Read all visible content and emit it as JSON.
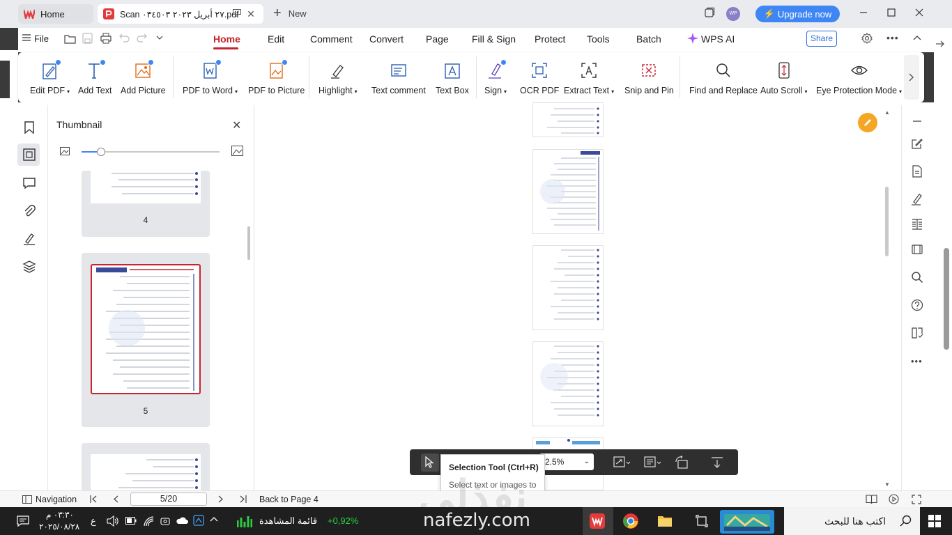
{
  "titlebar": {
    "tab_home": "Home",
    "tab_doc": "Scan ٢٧ أبريل ٢٠٢٣ ٠٣٤٥٠٣.pdf",
    "new_tab": "New",
    "avatar": "WP",
    "upgrade": "Upgrade now"
  },
  "menu": {
    "file": "File",
    "items": [
      "Home",
      "Edit",
      "Comment",
      "Convert",
      "Page",
      "Fill & Sign",
      "Protect",
      "Tools",
      "Batch"
    ],
    "wps_ai": "WPS AI",
    "share": "Share"
  },
  "ribbon": {
    "edit_pdf": "Edit PDF",
    "add_text": "Add Text",
    "add_picture": "Add Picture",
    "pdf_to_word": "PDF to Word",
    "pdf_to_picture": "PDF to Picture",
    "highlight": "Highlight",
    "text_comment": "Text comment",
    "text_box": "Text Box",
    "sign": "Sign",
    "ocr_pdf": "OCR PDF",
    "extract_text": "Extract Text",
    "snip_and_pin": "Snip and Pin",
    "find_replace": "Find and Replace",
    "auto_scroll": "Auto Scroll",
    "eye_protection": "Eye Protection Mode"
  },
  "thumbnail": {
    "title": "Thumbnail",
    "page_a": "4",
    "page_b": "5",
    "selected_page": 5
  },
  "float_toolbar": {
    "zoom": "2.5%"
  },
  "tooltip": {
    "title": "Selection Tool (Ctrl+R)",
    "desc": "Select text or images to copy"
  },
  "status": {
    "navigation": "Navigation",
    "page": "5/20",
    "back": "Back to Page 4"
  },
  "watermark": "نفذلي",
  "taskbar": {
    "time": "٠٣:٣٠ م",
    "date": "٢٠٢٥/٠٨/٢٨",
    "lang": "ع",
    "watchlist": "قائمة المشاهدة",
    "change": "+0,92%",
    "brand": "nafezly.com",
    "search": "اكتب هنا للبحث"
  },
  "colors": {
    "accent": "#c6242f",
    "blue": "#3f86f5",
    "green": "#2ecc40"
  }
}
